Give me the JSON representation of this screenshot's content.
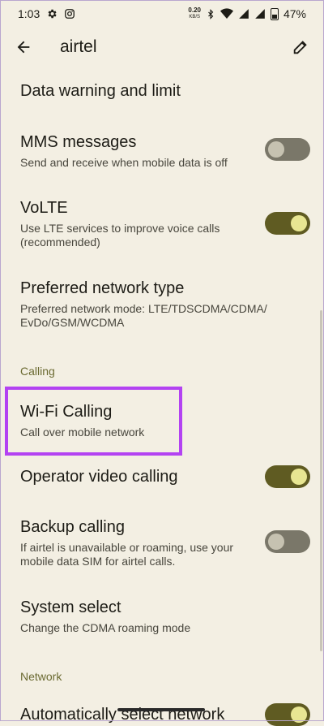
{
  "status": {
    "time": "1:03",
    "net_speed": "0.20",
    "net_unit": "KB/S",
    "battery": "47%"
  },
  "appbar": {
    "title": "airtel"
  },
  "items": [
    {
      "title": "Data warning and limit",
      "subtitle": ""
    },
    {
      "title": "MMS messages",
      "subtitle": "Send and receive when mobile data is off",
      "toggle": false
    },
    {
      "title": "VoLTE",
      "subtitle": "Use LTE services to improve voice calls (recommended)",
      "toggle": true
    },
    {
      "title": "Preferred network type",
      "subtitle": "Preferred network mode: LTE/TDSCDMA/CDMA/ EvDo/GSM/WCDMA"
    },
    {
      "title": "Wi-Fi Calling",
      "subtitle": "Call over mobile network"
    },
    {
      "title": "Operator video calling",
      "subtitle": "",
      "toggle": true
    },
    {
      "title": "Backup calling",
      "subtitle": "If airtel is unavailable or roaming, use your mobile data SIM for airtel calls.",
      "toggle": false
    },
    {
      "title": "System select",
      "subtitle": "Change the CDMA roaming mode"
    },
    {
      "title": "Automatically select network",
      "subtitle": "",
      "toggle": true
    }
  ],
  "sections": {
    "calling": "Calling",
    "network": "Network"
  },
  "colors": {
    "background": "#f3efe3",
    "toggle_on": "#5f5b22",
    "toggle_off": "#7a7769",
    "highlight": "#b342f2"
  }
}
